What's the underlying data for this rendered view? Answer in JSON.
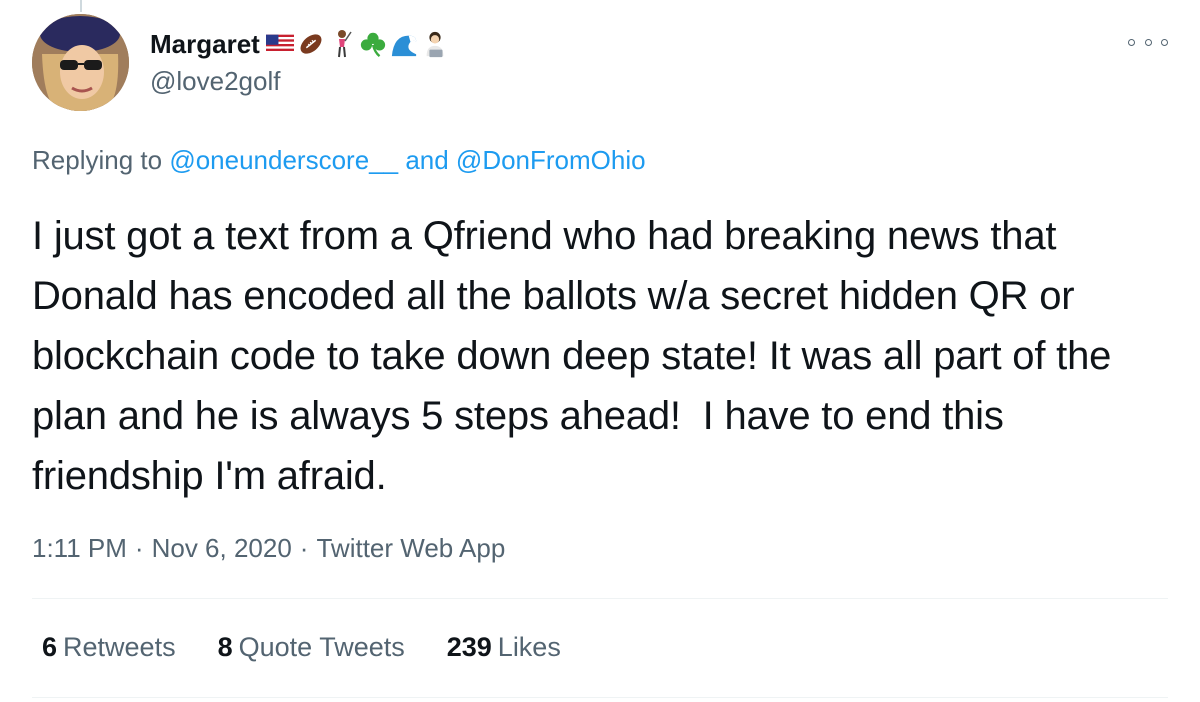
{
  "author": {
    "display_name": "Margaret",
    "handle": "@love2golf",
    "emojis": [
      "us-flag",
      "football",
      "golfer-woman",
      "shamrock",
      "wave",
      "woman-technologist"
    ]
  },
  "reply": {
    "prefix": "Replying to ",
    "mention_1": "@oneunderscore__",
    "joiner": " and ",
    "mention_2": "@DonFromOhio"
  },
  "tweet": {
    "text": "I just got a text from a Qfriend who had breaking news that Donald has encoded all the ballots w/a secret hidden QR or blockchain code to take down deep state! It was all part of the plan and he is always 5 steps ahead!  I have to end this friendship I'm afraid."
  },
  "meta": {
    "time": "1:11 PM",
    "separator": "·",
    "date": "Nov 6, 2020",
    "source": "Twitter Web App"
  },
  "stats": [
    {
      "count": "6",
      "label": "Retweets"
    },
    {
      "count": "8",
      "label": "Quote Tweets"
    },
    {
      "count": "239",
      "label": "Likes"
    }
  ],
  "colors": {
    "link": "#1d9bf0",
    "secondary_text": "#536471",
    "primary_text": "#0f1419",
    "divider": "#eff3f4"
  }
}
